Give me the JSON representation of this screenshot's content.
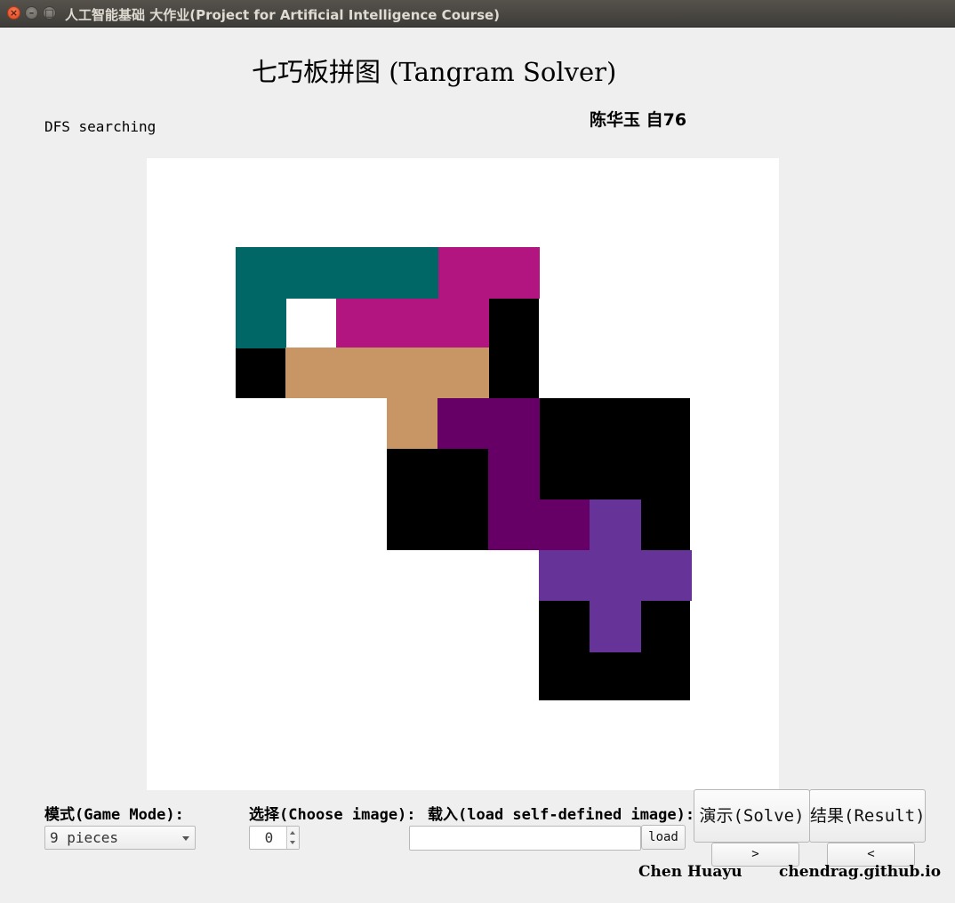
{
  "window": {
    "title": "人工智能基础 大作业(Project for Artificial Intelligence Course)",
    "close_glyph": "×",
    "minimize_glyph": "–",
    "maximize_glyph": "□"
  },
  "header": {
    "title": "七巧板拼图 (Tangram Solver)",
    "author_cn": "陈华玉 自76",
    "status": "DFS searching"
  },
  "puzzle": {
    "colors": {
      "background": "#ffffff",
      "target": "#000000",
      "teal": "#006666",
      "magenta": "#b31580",
      "tan": "#c89664",
      "dark_purple": "#660066",
      "violet": "#663399"
    },
    "pieces": [
      {
        "name": "teal",
        "color": "#006666"
      },
      {
        "name": "magenta",
        "color": "#b31580"
      },
      {
        "name": "tan",
        "color": "#c89664"
      },
      {
        "name": "dark-purple",
        "color": "#660066"
      },
      {
        "name": "violet",
        "color": "#663399"
      }
    ]
  },
  "controls": {
    "mode_label": "模式(Game Mode):",
    "mode_value": "9 pieces",
    "choose_label": "选择(Choose image):",
    "choose_value": "0",
    "load_label": "载入(load self-defined image):",
    "load_input_value": "",
    "load_button": "load",
    "solve_button": "演示(Solve)",
    "result_button": "结果(Result)",
    "next_button": ">",
    "prev_button": "<"
  },
  "footer": {
    "author_en": "Chen Huayu",
    "site": "chendrag.github.io"
  }
}
